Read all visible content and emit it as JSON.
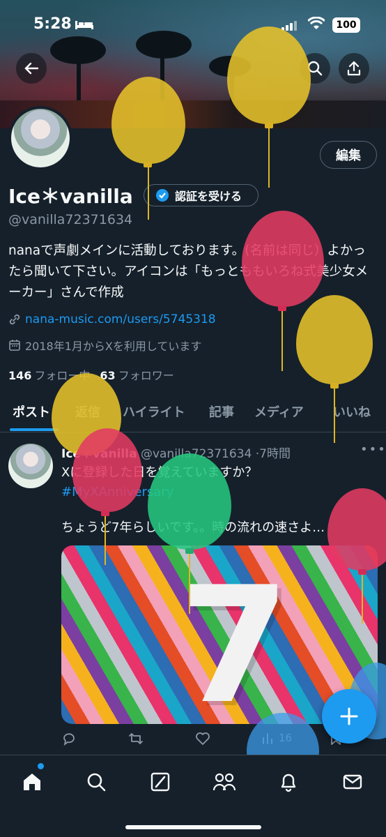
{
  "status_bar": {
    "time": "5:28",
    "battery": "100"
  },
  "profile": {
    "edit_label": "編集",
    "name": "Ice＊vanilla",
    "verify_label": "認証を受ける",
    "handle": "@vanilla72371634",
    "bio": "nanaで声劇メインに活動しております。(名前は同じ）よかったら聞いて下さい。アイコンは「もっとももいろね式美少女メーカー」さんで作成",
    "link": "nana-music.com/users/5745318",
    "joined": "2018年1月からXを利用しています",
    "following_count": "146",
    "following_label": "フォロー中",
    "followers_count": "63",
    "followers_label": "フォロワー"
  },
  "tabs": [
    "ポスト",
    "返信",
    "ハイライト",
    "記事",
    "メディア",
    "いいね"
  ],
  "post": {
    "author": "Ice＊vanilla",
    "handle": "@vanilla72371634",
    "time": "·7時間",
    "line1": "Xに登録した日を覚えていますか？",
    "hashtag": "#MyXAnniversary",
    "line2": "ちょうど7年らしいです。。時の流れの速さよ…",
    "media_number": "7",
    "views": "16"
  },
  "colors": {
    "accent": "#1d9bf0",
    "bg": "#15202b",
    "muted": "#8b98a5"
  },
  "icons": [
    "back-icon",
    "search-icon",
    "share-icon",
    "verified-icon",
    "link-icon",
    "calendar-icon",
    "more-icon",
    "reply-icon",
    "retweet-icon",
    "like-icon",
    "views-icon",
    "bookmark-icon",
    "compose-icon",
    "home-icon",
    "explore-icon",
    "grok-icon",
    "communities-icon",
    "notifications-icon",
    "messages-icon"
  ]
}
